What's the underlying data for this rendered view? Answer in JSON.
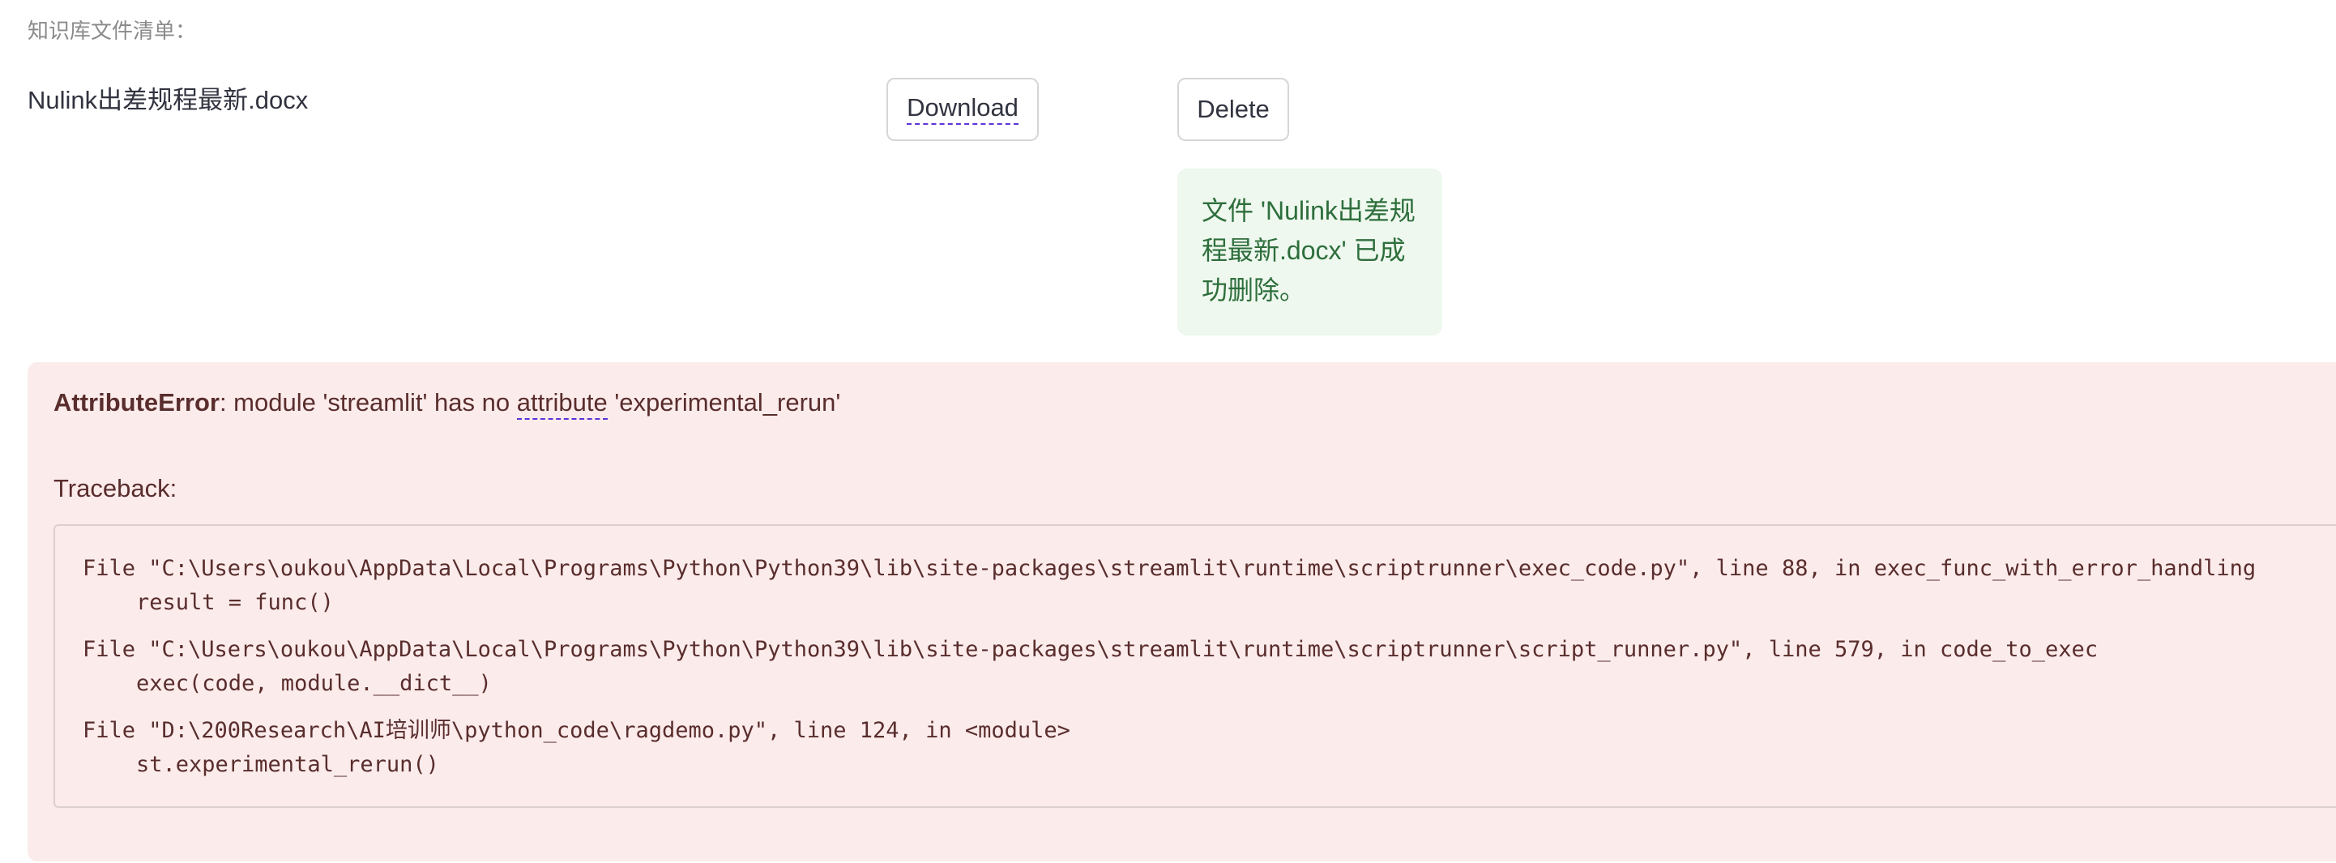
{
  "knowledge_base": {
    "section_label": "知识库文件清单：",
    "files": [
      {
        "name": "Nulink出差规程最新.docx",
        "download_label": "Download",
        "delete_label": "Delete"
      }
    ],
    "success_message": "文件 'Nulink出差规程最新.docx' 已成功删除。"
  },
  "error": {
    "type": "AttributeError",
    "message_prefix": ": module 'streamlit' has no ",
    "message_link": "attribute",
    "message_suffix": " 'experimental_rerun'",
    "traceback_label": "Traceback:",
    "frames": [
      {
        "file_line": "File \"C:\\Users\\oukou\\AppData\\Local\\Programs\\Python\\Python39\\lib\\site-packages\\streamlit\\runtime\\scriptrunner\\exec_code.py\", line 88, in exec_func_with_error_handling",
        "code": "result = func()"
      },
      {
        "file_line": "File \"C:\\Users\\oukou\\AppData\\Local\\Programs\\Python\\Python39\\lib\\site-packages\\streamlit\\runtime\\scriptrunner\\script_runner.py\", line 579, in code_to_exec",
        "code": "exec(code, module.__dict__)"
      },
      {
        "file_line": "File \"D:\\200Research\\AI培训师\\python_code\\ragdemo.py\", line 124, in <module>",
        "code": "st.experimental_rerun()"
      }
    ]
  }
}
